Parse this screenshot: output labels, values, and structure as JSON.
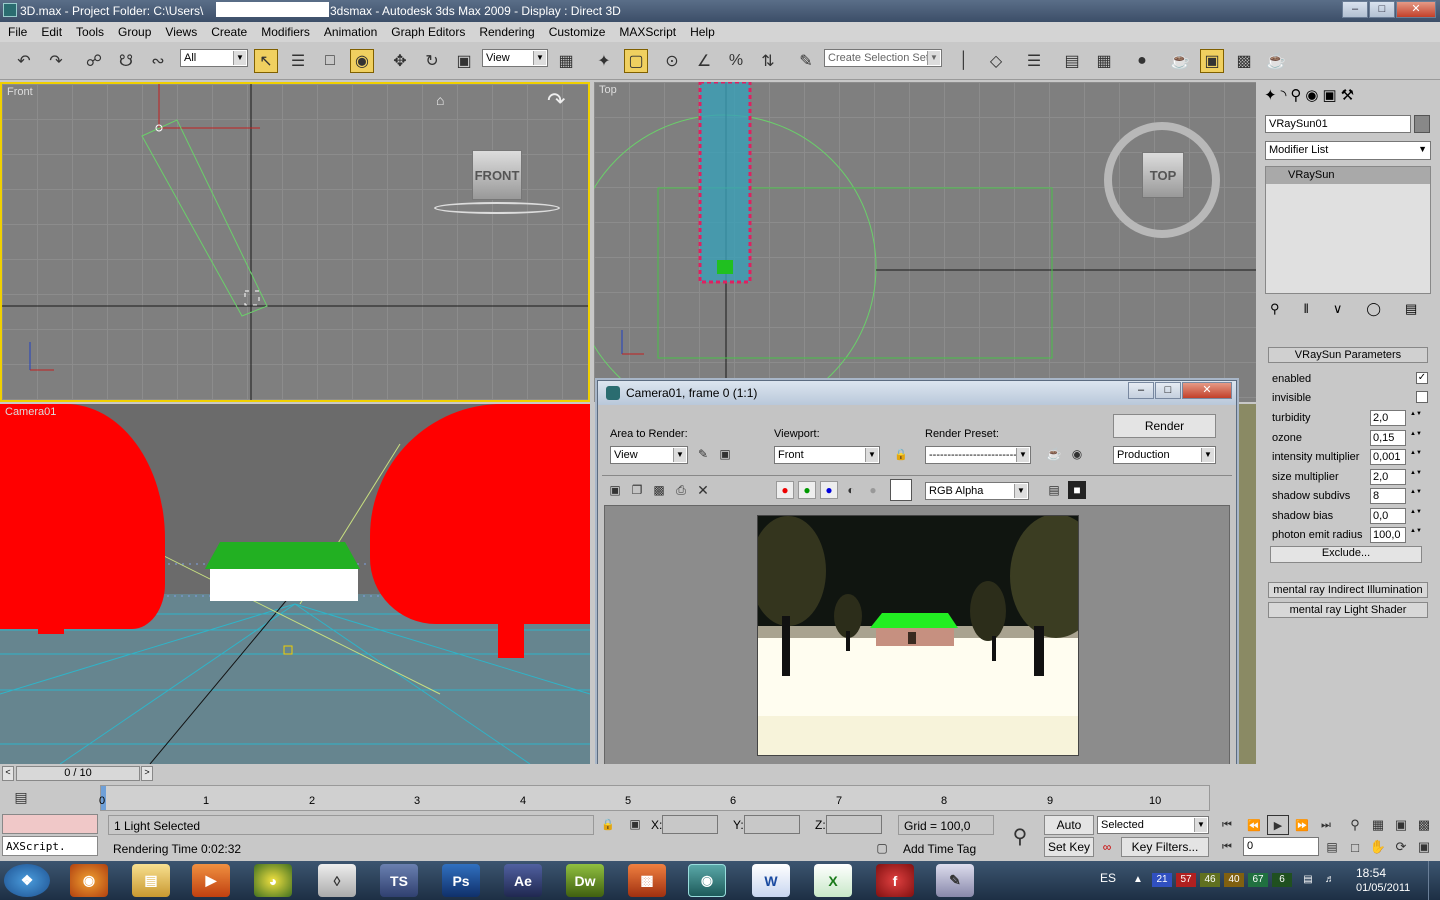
{
  "window": {
    "title": "3D.max   - Project Folder: C:\\Users\\",
    "title_suffix": "3dsmax    - Autodesk 3ds Max  2009      - Display : Direct 3D"
  },
  "menu": [
    "File",
    "Edit",
    "Tools",
    "Group",
    "Views",
    "Create",
    "Modifiers",
    "Animation",
    "Graph Editors",
    "Rendering",
    "Customize",
    "MAXScript",
    "Help"
  ],
  "toolbar": {
    "selection_filter": "All",
    "ref_coord": "View",
    "named_selection_placeholder": "Create Selection Set"
  },
  "viewports": {
    "front": {
      "label": "Front",
      "viewcube": "FRONT"
    },
    "top": {
      "label": "Top",
      "viewcube": "TOP"
    },
    "camera": {
      "label": "Camera01"
    }
  },
  "right_panel": {
    "object_name": "VRaySun01",
    "modifier_list": "Modifier List",
    "stack_item": "VRaySun",
    "rollout_title": "VRaySun Parameters",
    "params": [
      {
        "label": "enabled",
        "value": "",
        "checked": true
      },
      {
        "label": "invisible",
        "value": "",
        "checked": false
      },
      {
        "label": "turbidity",
        "value": "2,0"
      },
      {
        "label": "ozone",
        "value": "0,15"
      },
      {
        "label": "intensity multiplier",
        "value": "0,001"
      },
      {
        "label": "size multiplier",
        "value": "2,0"
      },
      {
        "label": "shadow subdivs",
        "value": "8"
      },
      {
        "label": "shadow bias",
        "value": "0,0"
      },
      {
        "label": "photon emit radius",
        "value": "100,0"
      }
    ],
    "exclude_label": "Exclude...",
    "rollout_2": "mental ray Indirect Illumination",
    "rollout_3": "mental ray Light Shader"
  },
  "render_window": {
    "title": "Camera01, frame 0 (1:1)",
    "area_label": "Area to Render:",
    "area_value": "View",
    "viewport_label": "Viewport:",
    "viewport_value": "Front",
    "preset_label": "Render Preset:",
    "preset_value": "-------------------------",
    "render_button": "Render",
    "production_value": "Production",
    "channel_value": "RGB Alpha"
  },
  "timeline": {
    "frame_counter": "0 / 10",
    "ticks": [
      "0",
      "1",
      "2",
      "3",
      "4",
      "5",
      "6",
      "7",
      "8",
      "9",
      "10"
    ]
  },
  "status": {
    "script_listener": "AXScript.",
    "selected_text": "1 Light Selected",
    "render_time": "Rendering Time  0:02:32",
    "x_label": "X:",
    "y_label": "Y:",
    "z_label": "Z:",
    "grid": "Grid = 100,0",
    "add_time_tag": "Add Time Tag",
    "auto_key": "Auto Key",
    "set_key": "Set Key",
    "key_mode": "Selected",
    "key_filters": "Key Filters...",
    "frame_value": "0"
  },
  "taskbar": {
    "lang": "ES",
    "time": "18:54",
    "date": "01/05/2011",
    "tray_numbers": [
      "21",
      "57",
      "46",
      "40",
      "67",
      "6"
    ]
  },
  "colors": {
    "active_viewport_border": "#f0d000",
    "trees": "#ff0000",
    "roof": "#22b022"
  }
}
